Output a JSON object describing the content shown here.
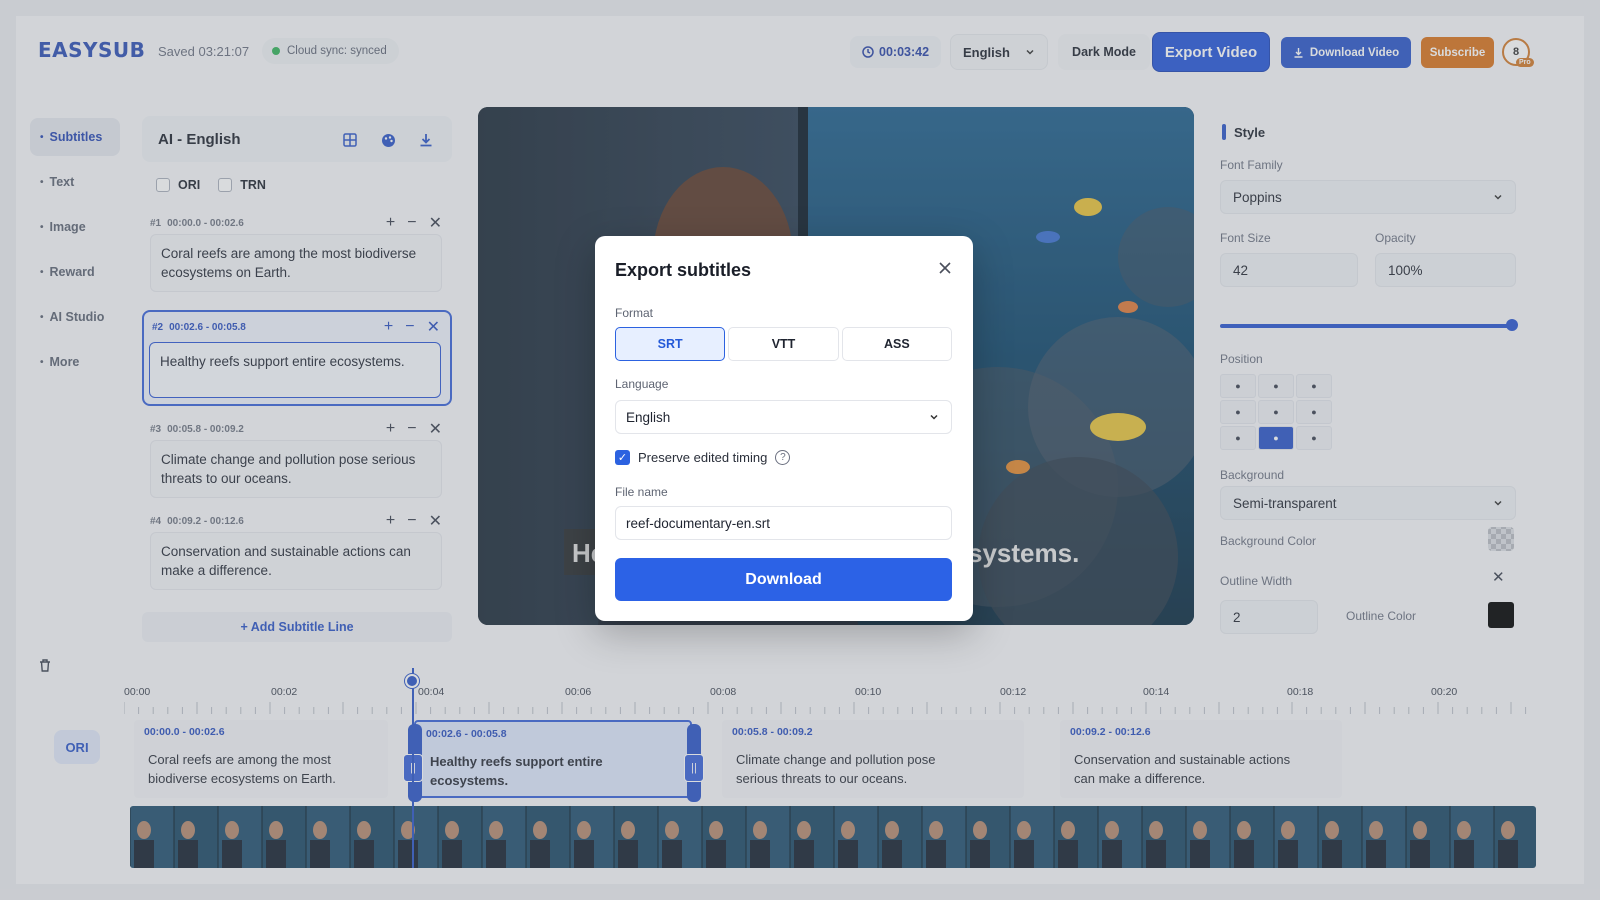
{
  "header": {
    "logo": "EASYSUB",
    "saved": "Saved 03:21:07",
    "cloud_sync": "Cloud sync: synced",
    "timer": "00:03:42",
    "language": "English",
    "dark_mode": "Dark Mode",
    "export_video": "Export Video",
    "download_video": "Download Video",
    "subscribe": "Subscribe",
    "avatar_initial": "8",
    "pro_badge": "Pro"
  },
  "sidebar": {
    "items": [
      {
        "label": "Subtitles",
        "active": true
      },
      {
        "label": "Text"
      },
      {
        "label": "Image"
      },
      {
        "label": "Reward"
      },
      {
        "label": "AI Studio"
      },
      {
        "label": "More"
      }
    ]
  },
  "subtitle_panel": {
    "title": "AI - English",
    "check_ori": "ORI",
    "check_trn": "TRN",
    "items": [
      {
        "num": "#1",
        "time": "00:00.0 - 00:02.6",
        "text": "Coral reefs are among the most biodiverse ecosystems on Earth."
      },
      {
        "num": "#2",
        "time": "00:02.6 - 00:05.8",
        "text": "Healthy reefs support entire ecosystems."
      },
      {
        "num": "#3",
        "time": "00:05.8 - 00:09.2",
        "text": "Climate change and pollution pose serious threats to our oceans."
      },
      {
        "num": "#4",
        "time": "00:09.2 - 00:12.6",
        "text": "Conservation and sustainable actions can make a difference."
      }
    ],
    "add_line": "+ Add Subtitle Line"
  },
  "video": {
    "caption_left": "He",
    "caption_right": "systems."
  },
  "style_panel": {
    "title": "Style",
    "font_family_label": "Font Family",
    "font_family": "Poppins",
    "font_size_label": "Font Size",
    "font_size": "42",
    "opacity_label": "Opacity",
    "opacity": "100%",
    "opacity_value": 1.0,
    "position_label": "Position",
    "background_label": "Background",
    "background": "Semi-transparent",
    "background_color_label": "Background Color",
    "outline_width_label": "Outline Width",
    "outline_width": "2",
    "outline_color_label": "Outline Color",
    "outline_color": "#000000"
  },
  "timeline": {
    "ruler": [
      "00:00",
      "00:02",
      "00:04",
      "00:06",
      "00:08",
      "00:10",
      "00:12",
      "00:14",
      "00:18",
      "00:20"
    ],
    "track_label": "ORI",
    "clips": [
      {
        "time": "00:00.0 - 00:02.6",
        "text": "Coral reefs are among the most biodiverse ecosystems on Earth."
      },
      {
        "time": "00:02.6 - 00:05.8",
        "text": "Healthy reefs support entire ecosystems."
      },
      {
        "time": "00:05.8 - 00:09.2",
        "text": "Climate change and pollution pose serious threats to our oceans."
      },
      {
        "time": "00:09.2 - 00:12.6",
        "text": "Conservation and sustainable actions can make a difference."
      }
    ]
  },
  "modal": {
    "title": "Export subtitles",
    "format_label": "Format",
    "formats": [
      "SRT",
      "VTT",
      "ASS"
    ],
    "selected_format": "SRT",
    "language_label": "Language",
    "language": "English",
    "preserve_timing": "Preserve edited timing",
    "file_name_label": "File name",
    "file_name": "reef-documentary-en.srt",
    "download": "Download"
  },
  "colors": {
    "accent": "#2c62e6",
    "subscribe": "#d9741e",
    "sync_dot": "#34b35a"
  }
}
